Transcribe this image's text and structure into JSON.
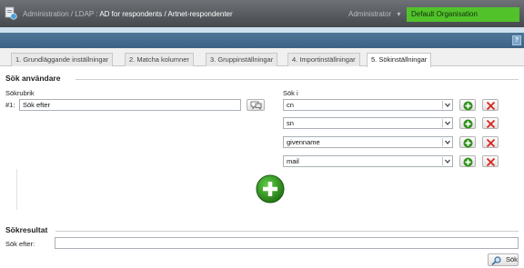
{
  "header": {
    "breadcrumb_prefix": "Administration / LDAP : ",
    "breadcrumb_current": "AD for respondents / Artnet-respondenter",
    "user_menu": "Administrator",
    "user_menu_caret": "▾",
    "organisation": "Default Organisation",
    "help_label": "?"
  },
  "tabs": [
    {
      "label": "1. Grundläggande inställningar"
    },
    {
      "label": "2. Matcha kolumner"
    },
    {
      "label": "3. Gruppinställningar"
    },
    {
      "label": "4. Importinställningar"
    },
    {
      "label": "5. Sökinställningar"
    }
  ],
  "active_tab": "5. Sökinställningar",
  "search_users": {
    "title": "Sök användare",
    "rubric_label": "Sökrubrik",
    "row_prefix": "#1:",
    "rubric_value": "Sök efter",
    "search_in_label": "Sök i",
    "fields": [
      "cn",
      "sn",
      "givenname",
      "mail"
    ]
  },
  "results": {
    "title": "Sökresultat",
    "search_for_label": "Sök efter:",
    "search_for_value": "",
    "search_button": "Sök"
  },
  "colors": {
    "organisation_bg": "#52c22b",
    "title_bar": "#55595d",
    "steel_bar": "#3c6386",
    "add_green": "#2e8f1a",
    "remove_red": "#d9261c"
  }
}
